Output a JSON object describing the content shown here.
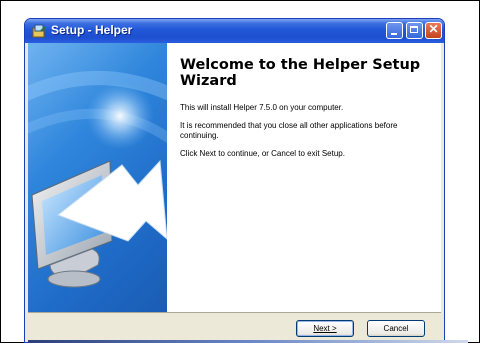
{
  "window": {
    "title": "Setup - Helper",
    "icon": "setup-installer-icon",
    "controls": [
      "minimize-icon",
      "maximize-icon",
      "close-icon"
    ]
  },
  "banner": {
    "icon": "monitor-with-arrow-illustration"
  },
  "content": {
    "heading": "Welcome to the Helper Setup Wizard",
    "paragraphs": [
      "This will install Helper 7.5.0 on your computer.",
      "It is recommended that you close all other applications before continuing.",
      "Click Next to continue, or Cancel to exit Setup."
    ]
  },
  "buttons": {
    "next_label": "Next >",
    "cancel_label": "Cancel"
  },
  "colors": {
    "titlebar": "#2157d8",
    "window_face": "#ece9d8",
    "banner": "#2f86dc",
    "close_button": "#c4441c"
  }
}
